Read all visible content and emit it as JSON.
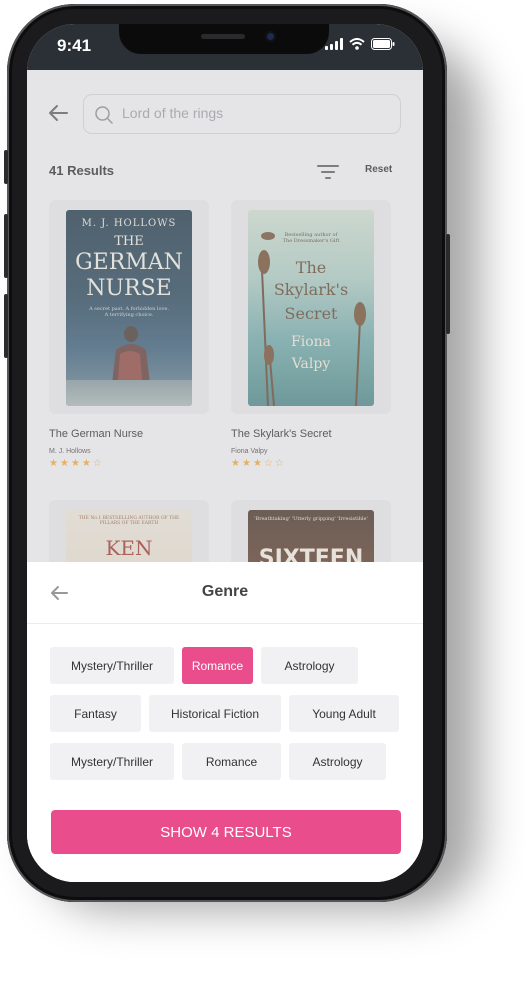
{
  "status_bar": {
    "time": "9:41"
  },
  "search": {
    "placeholder": "Lord of the rings"
  },
  "results": {
    "count_label": "41 Results",
    "reset_label": "Reset"
  },
  "books": [
    {
      "title": "The German Nurse",
      "author": "M. J. Hollows",
      "rating": 4,
      "max_rating": 5,
      "cover_lines": [
        "M. J. HOLLOWS",
        "THE",
        "GERMAN",
        "NURSE"
      ],
      "cover_tagline": "A secret past. A forbidden love. A terrifying choice."
    },
    {
      "title": "The Skylark's Secret",
      "author": "Fiona Valpy",
      "rating": 3,
      "max_rating": 5,
      "cover_lines": [
        "The",
        "Skylark's",
        "Secret",
        "Fiona",
        "Valpy"
      ],
      "cover_tagline": "Bestselling author of The Dressmaker's Gift"
    },
    {
      "cover_lines": [
        "KEN"
      ],
      "cover_tagline": "THE No.1 BESTSELLING AUTHOR OF THE PILLARS OF THE EARTH"
    },
    {
      "cover_lines": [
        "SIXTEEN"
      ],
      "cover_tagline": "'Breathtaking' 'Utterly gripping' 'Irresistible'"
    }
  ],
  "sheet": {
    "title": "Genre",
    "chips": [
      {
        "label": "Mystery/Thriller",
        "selected": false
      },
      {
        "label": "Romance",
        "selected": true
      },
      {
        "label": "Astrology",
        "selected": false
      },
      {
        "label": "Fantasy",
        "selected": false
      },
      {
        "label": "Historical Fiction",
        "selected": false
      },
      {
        "label": "Young Adult",
        "selected": false
      },
      {
        "label": "Mystery/Thriller",
        "selected": false
      },
      {
        "label": "Romance",
        "selected": false
      },
      {
        "label": "Astrology",
        "selected": false
      }
    ],
    "cta_label": "SHOW 4 RESULTS"
  },
  "colors": {
    "accent": "#ea4d8c",
    "star": "#f4a52a",
    "status_bar": "#2b2f36"
  },
  "icons": [
    "back-arrow-icon",
    "search-icon",
    "filter-icon",
    "signal-icon",
    "wifi-icon",
    "battery-icon"
  ]
}
